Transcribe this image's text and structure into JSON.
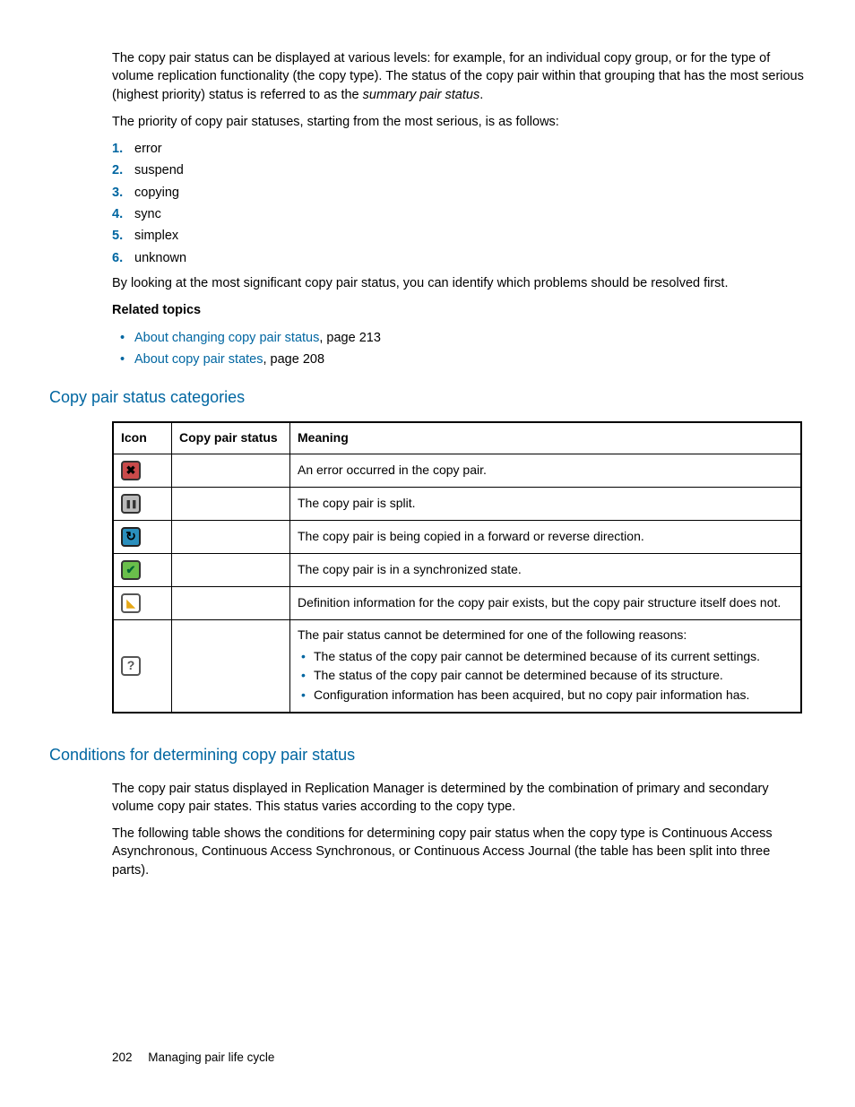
{
  "intro": {
    "p1_a": "The copy pair status can be displayed at various levels: for example, for an individual copy group, or for the type of volume replication functionality (the copy type). The status of the copy pair within that grouping that has the most serious (highest priority) status is referred to as the ",
    "p1_b": "summary pair status",
    "p1_c": ".",
    "p2": "The priority of copy pair statuses, starting from the most serious, is as follows:"
  },
  "priority": [
    "error",
    "suspend",
    "copying",
    "sync",
    "simplex",
    "unknown"
  ],
  "after_list": "By looking at the most significant copy pair status, you can identify which problems should be resolved first.",
  "related_heading": "Related topics",
  "related": [
    {
      "link": "About changing copy pair status",
      "suffix": ", page 213"
    },
    {
      "link": "About copy pair states",
      "suffix": ", page 208"
    }
  ],
  "section1": "Copy pair status categories",
  "table": {
    "headers": [
      "Icon",
      "Copy pair status",
      "Meaning"
    ],
    "rows": [
      {
        "icon": "error",
        "status": "",
        "meaning": "An error occurred in the copy pair."
      },
      {
        "icon": "pause",
        "status": "",
        "meaning": "The copy pair is split."
      },
      {
        "icon": "sync",
        "status": "",
        "meaning": "The copy pair is being copied in a forward or reverse direction."
      },
      {
        "icon": "check",
        "status": "",
        "meaning": "The copy pair is in a synchronized state."
      },
      {
        "icon": "def",
        "status": "",
        "meaning": "Definition information for the copy pair exists, but the copy pair structure itself does not."
      },
      {
        "icon": "unknown",
        "status": "",
        "meaning_intro": "The pair status cannot be determined for one of the following reasons:",
        "reasons": [
          "The status of the copy pair cannot be determined because of its current settings.",
          "The status of the copy pair cannot be determined because of its structure.",
          "Configuration information has been acquired, but no copy pair information has."
        ]
      }
    ]
  },
  "section2": "Conditions for determining copy pair status",
  "conditions": {
    "p1": "The copy pair status displayed in Replication Manager is determined by the combination of primary and secondary volume copy pair states. This status varies according to the copy type.",
    "p2": "The following table shows the conditions for determining copy pair status when the copy type is Continuous Access Asynchronous, Continuous Access Synchronous, or Continuous Access Journal (the table has been split into three parts)."
  },
  "footer": {
    "page": "202",
    "title": "Managing pair life cycle"
  }
}
